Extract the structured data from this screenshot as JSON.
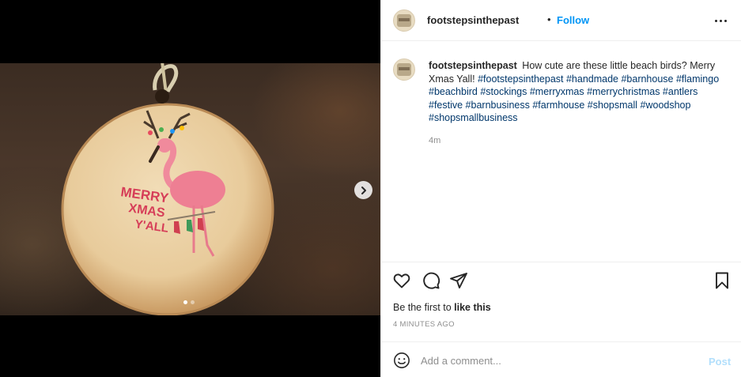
{
  "post": {
    "username": "footstepsinthepast",
    "separator": "•",
    "follow_label": "Follow",
    "more_icon": "more-horizontal-icon"
  },
  "caption": {
    "username": "footstepsinthepast",
    "text": "How cute are these little beach birds? Merry Xmas Yall!",
    "hashtags": "#footstepsinthepast #handmade #barnhouse #flamingo #beachbird #stockings #merryxmas #merrychristmas #antlers #festive #barnbusiness #farmhouse #shopsmall #woodshop #shopsmallbusiness",
    "time": "4m"
  },
  "media": {
    "ornament_text_line1": "MERRY",
    "ornament_text_line2": "XMAS",
    "ornament_text_line3": "Y'ALL",
    "carousel_count": 2,
    "carousel_index": 1,
    "next_icon": "chevron-right-icon"
  },
  "actions": {
    "like_icon": "heart-icon",
    "comment_icon": "comment-icon",
    "share_icon": "paper-plane-icon",
    "save_icon": "bookmark-icon",
    "likes_prefix": "Be the first to ",
    "likes_link": "like this",
    "timestamp": "4 MINUTES AGO"
  },
  "comment": {
    "emoji_icon": "smiley-icon",
    "placeholder": "Add a comment...",
    "post_label": "Post"
  },
  "colors": {
    "accent": "#0095f6",
    "post_disabled": "#b2dffc",
    "hashtag": "#00376b",
    "muted": "#8e8e8e"
  }
}
